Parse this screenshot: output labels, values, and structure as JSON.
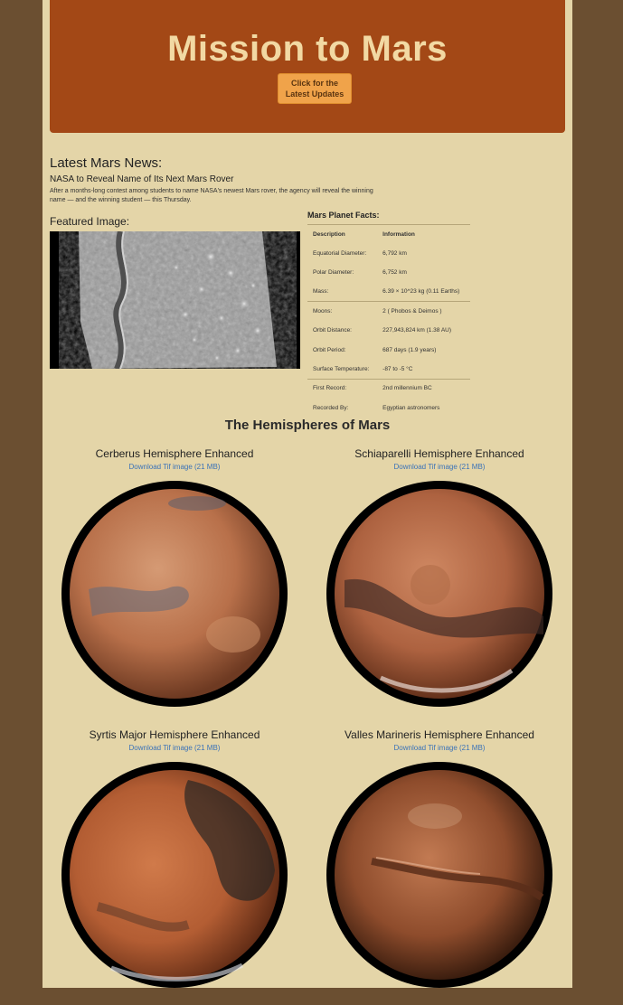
{
  "header": {
    "title": "Mission to Mars",
    "button_label": "Click for the\nLatest Updates"
  },
  "news": {
    "heading": "Latest Mars News:",
    "title": "NASA to Reveal Name of Its Next Mars Rover",
    "paragraph": "After a months-long contest among students to name NASA's newest Mars rover, the agency will reveal the winning name — and the winning student — this Thursday."
  },
  "featured": {
    "heading": "Featured Image:"
  },
  "facts": {
    "title": "Mars Planet Facts:",
    "columns": [
      "Description",
      "Information"
    ],
    "rows": [
      [
        "Equatorial Diameter:",
        "6,792 km"
      ],
      [
        "Polar Diameter:",
        "6,752 km"
      ],
      [
        "Mass:",
        "6.39 × 10^23 kg (0.11 Earths)"
      ],
      [
        "Moons:",
        "2 ( Phobos & Deimos )"
      ],
      [
        "Orbit Distance:",
        "227,943,824 km (1.38 AU)"
      ],
      [
        "Orbit Period:",
        "687 days (1.9 years)"
      ],
      [
        "Surface Temperature:",
        "-87 to -5 °C"
      ],
      [
        "First Record:",
        "2nd millennium BC"
      ],
      [
        "Recorded By:",
        "Egyptian astronomers"
      ]
    ]
  },
  "hemispheres": {
    "heading": "The Hemispheres of Mars",
    "items": [
      {
        "title": "Cerberus Hemisphere Enhanced",
        "link": "Download Tif image (21 MB)"
      },
      {
        "title": "Schiaparelli Hemisphere Enhanced",
        "link": "Download Tif image (21 MB)"
      },
      {
        "title": "Syrtis Major Hemisphere Enhanced",
        "link": "Download Tif image (21 MB)"
      },
      {
        "title": "Valles Marineris Hemisphere Enhanced",
        "link": "Download Tif image (21 MB)"
      }
    ]
  },
  "colors": {
    "page_bg": "#6b4f31",
    "panel_bg": "#e4d5a8",
    "jumbotron": "#a34816",
    "button": "#f0a34a",
    "link": "#3a72b8"
  }
}
